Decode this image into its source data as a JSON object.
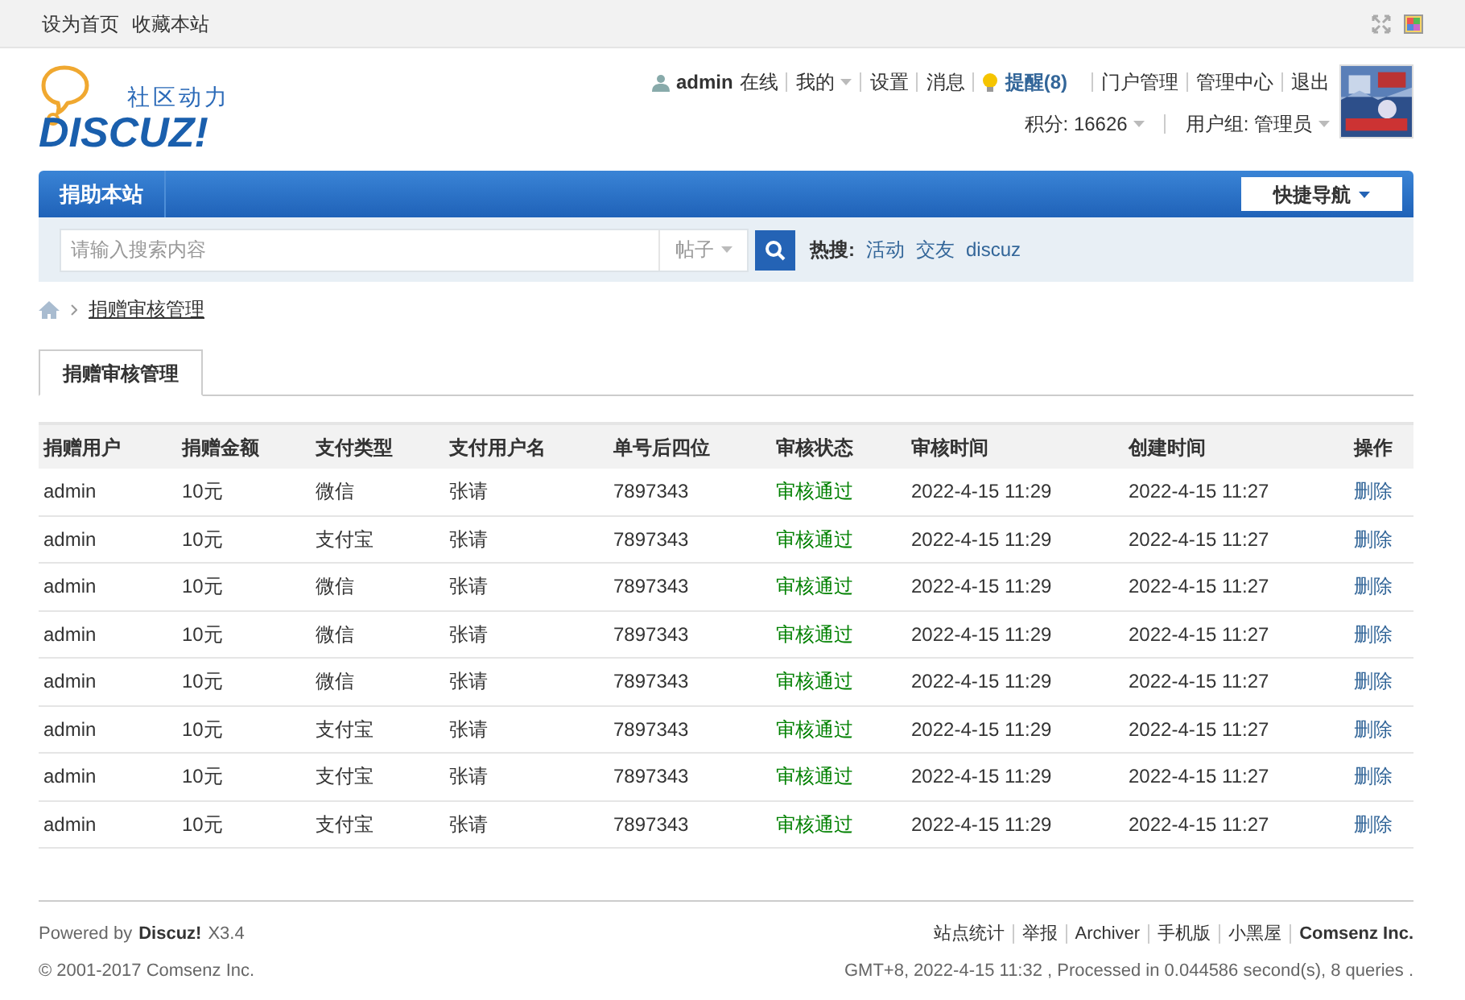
{
  "topbar": {
    "links": [
      "设为首页",
      "收藏本站"
    ]
  },
  "logo": {
    "slogan": "社区动力",
    "wordmark": "DISCUZ!"
  },
  "user_menu": {
    "username": "admin",
    "status": "在线",
    "items": [
      {
        "label": "我的",
        "dropdown": true
      },
      {
        "label": "设置",
        "dropdown": false
      },
      {
        "label": "消息",
        "dropdown": false
      }
    ],
    "reminder": "提醒(8)",
    "admin_links": [
      "门户管理",
      "管理中心",
      "退出"
    ],
    "points": "积分: 16626",
    "group": "用户组: 管理员"
  },
  "nav": {
    "items": [
      "捐助本站"
    ],
    "quick_nav": "快捷导航"
  },
  "search": {
    "placeholder": "请输入搜索内容",
    "scope": "帖子",
    "hot_label": "热搜:",
    "hot_terms": [
      "活动",
      "交友",
      "discuz"
    ]
  },
  "breadcrumb": [
    "捐赠审核管理"
  ],
  "tabs": [
    {
      "label": "捐赠审核管理",
      "selected": true
    }
  ],
  "table": {
    "columns": [
      "捐赠用户",
      "捐赠金额",
      "支付类型",
      "支付用户名",
      "单号后四位",
      "审核状态",
      "审核时间",
      "创建时间",
      "操作"
    ],
    "rows": [
      [
        "admin",
        "10元",
        "微信",
        "张请",
        "7897343",
        "审核通过",
        "2022-4-15 11:29",
        "2022-4-15 11:27",
        "删除"
      ],
      [
        "admin",
        "10元",
        "支付宝",
        "张请",
        "7897343",
        "审核通过",
        "2022-4-15 11:29",
        "2022-4-15 11:27",
        "删除"
      ],
      [
        "admin",
        "10元",
        "微信",
        "张请",
        "7897343",
        "审核通过",
        "2022-4-15 11:29",
        "2022-4-15 11:27",
        "删除"
      ],
      [
        "admin",
        "10元",
        "微信",
        "张请",
        "7897343",
        "审核通过",
        "2022-4-15 11:29",
        "2022-4-15 11:27",
        "删除"
      ],
      [
        "admin",
        "10元",
        "微信",
        "张请",
        "7897343",
        "审核通过",
        "2022-4-15 11:29",
        "2022-4-15 11:27",
        "删除"
      ],
      [
        "admin",
        "10元",
        "支付宝",
        "张请",
        "7897343",
        "审核通过",
        "2022-4-15 11:29",
        "2022-4-15 11:27",
        "删除"
      ],
      [
        "admin",
        "10元",
        "支付宝",
        "张请",
        "7897343",
        "审核通过",
        "2022-4-15 11:29",
        "2022-4-15 11:27",
        "删除"
      ],
      [
        "admin",
        "10元",
        "支付宝",
        "张请",
        "7897343",
        "审核通过",
        "2022-4-15 11:29",
        "2022-4-15 11:27",
        "删除"
      ]
    ]
  },
  "footer": {
    "powered_prefix": "Powered by",
    "powered_brand": "Discuz!",
    "version": "X3.4",
    "copyright": "© 2001-2017 Comsenz Inc.",
    "links": [
      "站点统计",
      "举报",
      "Archiver",
      "手机版",
      "小黑屋"
    ],
    "company": "Comsenz Inc.",
    "stats": "GMT+8, 2022-4-15 11:32 , Processed in 0.044586 second(s), 8 queries ."
  }
}
